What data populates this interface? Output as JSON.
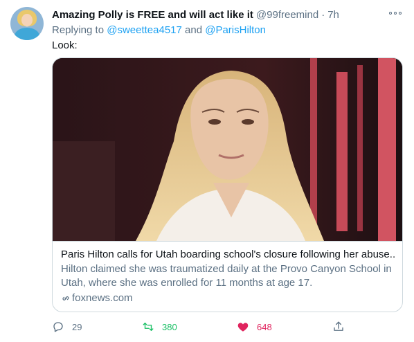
{
  "tweet": {
    "author_name": "Amazing Polly is FREE and will act like it",
    "author_handle": "@99freemind",
    "separator": "·",
    "time": "7h",
    "replying_prefix": "Replying to",
    "replying_users": [
      "@sweettea4517",
      "@ParisHilton"
    ],
    "replying_and": "and",
    "text": "Look:"
  },
  "card": {
    "title": "Paris Hilton calls for Utah boarding school's closure following her abuse...",
    "description": "Hilton claimed she was traumatized daily at the Provo Canyon School in Utah, where she was enrolled for 11 months at age 17.",
    "domain": "foxnews.com"
  },
  "actions": {
    "reply_count": "29",
    "retweet_count": "380",
    "like_count": "648"
  },
  "colors": {
    "link": "#1da1f2",
    "retweet": "#17bf63",
    "like": "#e0245e",
    "muted": "#5b7083"
  },
  "icons": [
    "more-icon",
    "link-icon",
    "reply-icon",
    "retweet-icon",
    "heart-icon",
    "share-icon"
  ]
}
